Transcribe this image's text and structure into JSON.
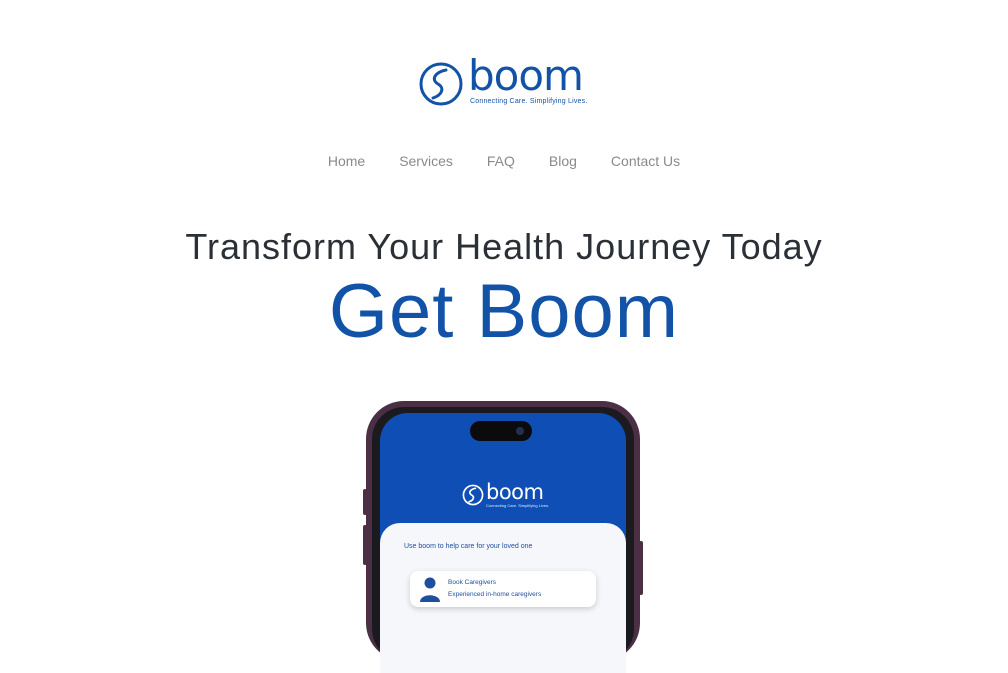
{
  "brand": {
    "name": "boom",
    "tagline": "Connecting Care. Simplifying Lives."
  },
  "nav": [
    {
      "label": "Home"
    },
    {
      "label": "Services"
    },
    {
      "label": "FAQ"
    },
    {
      "label": "Blog"
    },
    {
      "label": "Contact Us"
    }
  ],
  "hero": {
    "headline": "Transform Your Health Journey Today",
    "cta_title": "Get Boom"
  },
  "phone_app": {
    "brand_name": "boom",
    "tagline": "Connecting Care. Simplifying Lives.",
    "intro": "Use boom to help care for your loved one",
    "cards": [
      {
        "title": "Book Caregivers",
        "subtitle": "Experienced in-home caregivers",
        "icon": "caregiver-icon"
      }
    ]
  },
  "colors": {
    "brand_blue": "#1253a8",
    "screen_blue": "#0f4fb5",
    "heading": "#2b2f36",
    "nav_text": "#8a8a8a",
    "phone_frame": "#4b2f45"
  }
}
